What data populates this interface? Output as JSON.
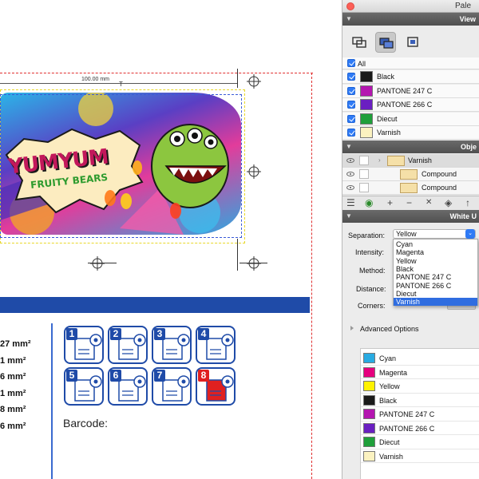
{
  "palette": {
    "title": "Pale",
    "view_header": "View",
    "all_label": "All",
    "separations": [
      {
        "name": "Black",
        "color": "#1a1a1a"
      },
      {
        "name": "PANTONE 247 C",
        "color": "#b416b0"
      },
      {
        "name": "PANTONE 266 C",
        "color": "#6a1fc1"
      },
      {
        "name": "Diecut",
        "color": "#1f9f3a"
      },
      {
        "name": "Varnish",
        "color": "#fbf2c0"
      }
    ],
    "objects_header": "Obje",
    "objects": [
      {
        "label": "Varnish"
      },
      {
        "label": "Compound"
      },
      {
        "label": "Compound"
      }
    ],
    "white_header": "White U",
    "fields": {
      "separation_label": "Separation:",
      "separation_value": "Yellow",
      "intensity_label": "Intensity:",
      "method_label": "Method:",
      "distance_label": "Distance:",
      "corners_label": "Corners:"
    },
    "dropdown_options": [
      "Cyan",
      "Magenta",
      "Yellow",
      "Black",
      "PANTONE 247 C",
      "PANTONE 266 C",
      "Diecut",
      "Varnish"
    ],
    "dropdown_highlight": "Varnish",
    "advanced_label": "Advanced Options",
    "inks": [
      {
        "name": "Cyan",
        "color": "#29abe2"
      },
      {
        "name": "Magenta",
        "color": "#e5007e"
      },
      {
        "name": "Yellow",
        "color": "#fff200"
      },
      {
        "name": "Black",
        "color": "#1a1a1a"
      },
      {
        "name": "PANTONE 247 C",
        "color": "#b416b0"
      },
      {
        "name": "PANTONE 266 C",
        "color": "#6a1fc1"
      },
      {
        "name": "Diecut",
        "color": "#1f9f3a"
      },
      {
        "name": "Varnish",
        "color": "#fbf2c0"
      }
    ]
  },
  "canvas": {
    "dimension_label": "100.00 mm",
    "artwork": {
      "brand_top": "YUMYUM",
      "brand_sub": "FRUITY BEARS"
    },
    "measurements": [
      "27 mm²",
      "1 mm²",
      "6 mm²",
      "1 mm²",
      "8 mm²",
      "6 mm²"
    ],
    "stations": [
      "1",
      "2",
      "3",
      "4",
      "5",
      "6",
      "7",
      "8"
    ],
    "barcode_label": "Barcode:"
  }
}
